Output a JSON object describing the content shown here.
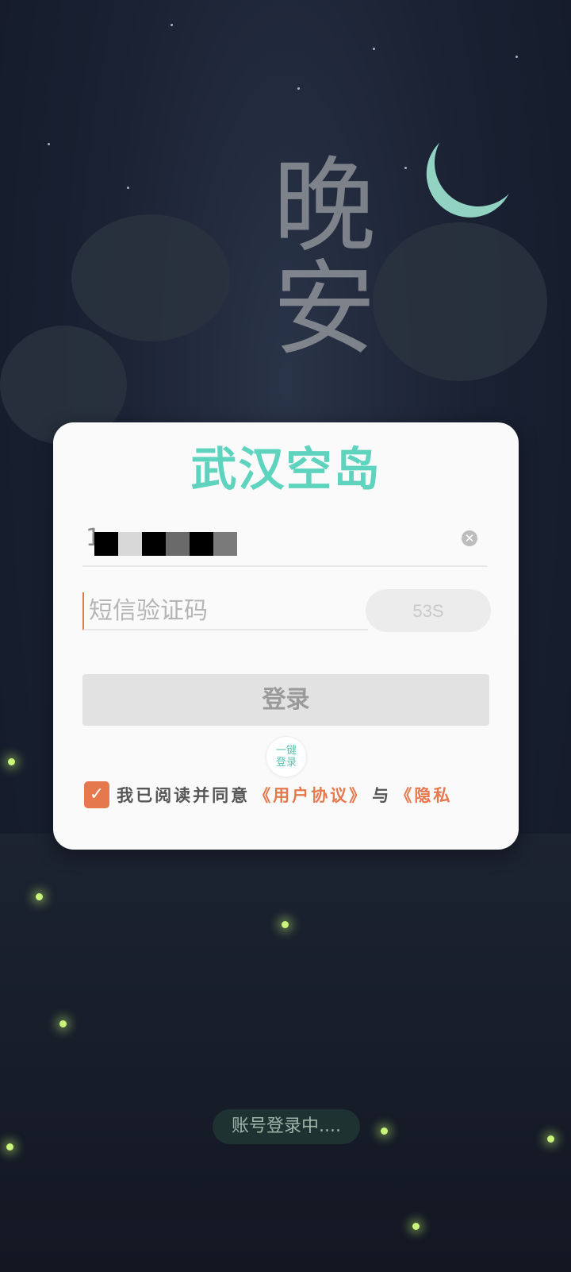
{
  "background": {
    "calligraphy": "晚安",
    "status_text": "账号登录中...."
  },
  "card": {
    "brand": "武汉空岛",
    "phone": {
      "prefix": "1",
      "clear_icon": "close-circle-icon"
    },
    "code": {
      "placeholder": "短信验证码",
      "countdown_label": "53S"
    },
    "login_label": "登录",
    "onekey": {
      "line1": "一键",
      "line2": "登录"
    },
    "agreement": {
      "checked": true,
      "prefix": "我已阅读并同意",
      "user_agreement": "《用户协议》",
      "conjunction": "与",
      "privacy": "《隐私"
    }
  },
  "colors": {
    "accent": "#e6784d",
    "brand": "#5ed3be",
    "button_disabled": "#e2e2e2"
  }
}
